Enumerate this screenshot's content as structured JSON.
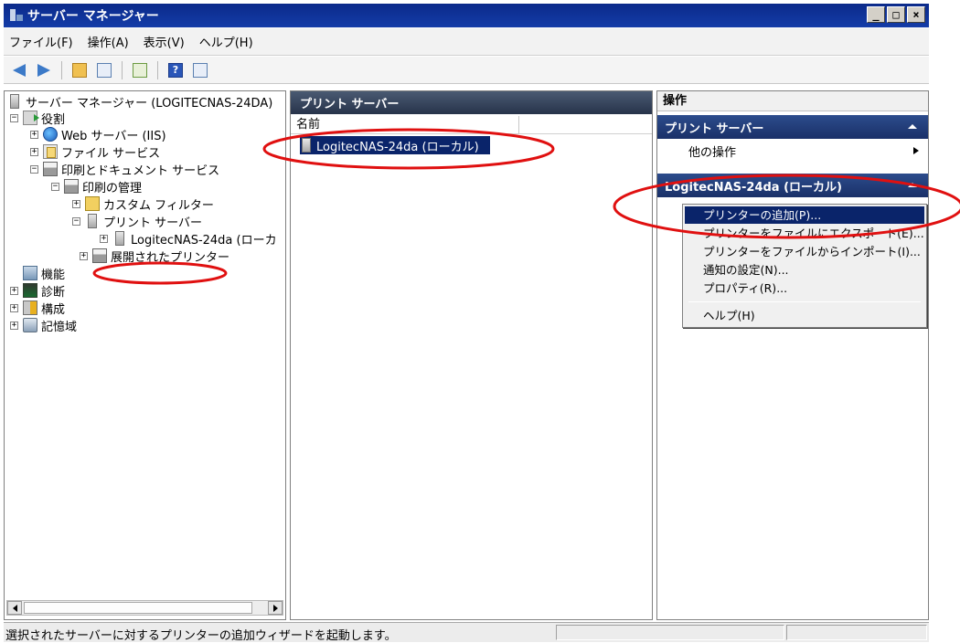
{
  "window": {
    "title": "サーバー マネージャー",
    "buttons": [
      "_",
      "□",
      "×"
    ]
  },
  "menu": [
    "ファイル(F)",
    "操作(A)",
    "表示(V)",
    "ヘルプ(H)"
  ],
  "toolbar": {
    "icons": [
      "back-arrow-icon",
      "forward-arrow-icon",
      "up-folder-icon",
      "show-hide-tree-icon",
      "export-list-icon",
      "help-icon",
      "show-hide-action-icon"
    ],
    "help_glyph": "?"
  },
  "tree": {
    "root": "サーバー マネージャー (LOGITECNAS-24DA)",
    "roles": "役割",
    "web_server": "Web サーバー (IIS)",
    "file_services": "ファイル サービス",
    "print_services": "印刷とドキュメント サービス",
    "print_management": "印刷の管理",
    "custom_filters": "カスタム フィルター",
    "print_servers": "プリント サーバー",
    "logitec_server": "LogitecNAS-24da (ローカ",
    "deployed_printers": "展開されたプリンター",
    "features": "機能",
    "diagnostics": "診断",
    "configuration": "構成",
    "storage": "記憶域",
    "expander_plus": "+",
    "expander_minus": "−"
  },
  "list": {
    "header": "プリント サーバー",
    "columns": [
      "名前",
      ""
    ],
    "rows": [
      "LogitecNAS-24da (ローカル)"
    ]
  },
  "actions": {
    "title": "操作",
    "group1": "プリント サーバー",
    "other_actions": "他の操作",
    "group2": "LogitecNAS-24da (ローカル)"
  },
  "context_menu": {
    "items": [
      "プリンターの追加(P)...",
      "プリンターをファイルにエクスポート(E)...",
      "プリンターをファイルからインポート(I)...",
      "通知の設定(N)...",
      "プロパティ(R)...",
      "ヘルプ(H)"
    ],
    "highlighted_index": 0
  },
  "status": {
    "text": "選択されたサーバーに対するプリンターの追加ウィザードを起動します。"
  },
  "colors": {
    "titlebar": "#0b2a8a",
    "selection": "#0a246a",
    "annotation": "#e01010",
    "pane_header": "#27334a"
  }
}
